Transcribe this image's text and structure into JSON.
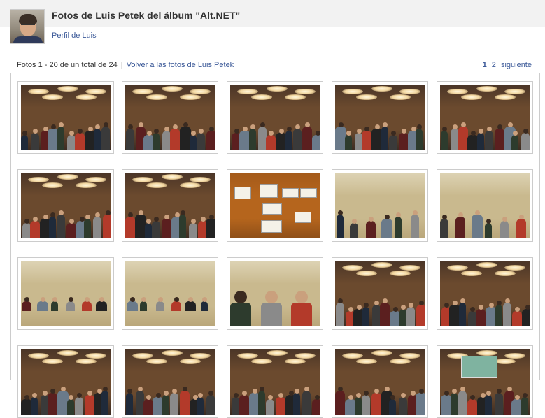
{
  "header": {
    "title": "Fotos de Luis Petek del álbum \"Alt.NET\"",
    "profile_link": "Perfil de Luis"
  },
  "infobar": {
    "count_text": "Fotos 1 - 20 de un total de 24",
    "separator": "|",
    "back_link": "Volver a las fotos de Luis Petek",
    "pages": [
      "1",
      "2"
    ],
    "current_page": "1",
    "next_label": "siguiente"
  },
  "colors": {
    "link": "#3b5998",
    "header_bg": "#f2f2f2",
    "border": "#cccccc"
  },
  "photos": [
    {
      "scene": "meeting-room-crowd",
      "tone": "warm"
    },
    {
      "scene": "meeting-room-crowd",
      "tone": "warm"
    },
    {
      "scene": "meeting-room-crowd",
      "tone": "warm"
    },
    {
      "scene": "meeting-room-crowd",
      "tone": "warm"
    },
    {
      "scene": "meeting-room-crowd",
      "tone": "warm"
    },
    {
      "scene": "meeting-room-crowd",
      "tone": "warm"
    },
    {
      "scene": "meeting-room-crowd",
      "tone": "warm"
    },
    {
      "scene": "wall-with-notes",
      "tone": "orange"
    },
    {
      "scene": "people-seated",
      "tone": "beige"
    },
    {
      "scene": "people-seated",
      "tone": "beige"
    },
    {
      "scene": "circle-of-chairs",
      "tone": "beige"
    },
    {
      "scene": "circle-of-chairs",
      "tone": "beige"
    },
    {
      "scene": "close-faces",
      "tone": "beige"
    },
    {
      "scene": "meeting-room-crowd",
      "tone": "warm"
    },
    {
      "scene": "meeting-room-crowd",
      "tone": "warm"
    },
    {
      "scene": "partial-row",
      "tone": "warm"
    },
    {
      "scene": "partial-row",
      "tone": "warm"
    },
    {
      "scene": "partial-row",
      "tone": "warm"
    },
    {
      "scene": "partial-row",
      "tone": "warm"
    },
    {
      "scene": "projector-screen",
      "tone": "warm"
    }
  ]
}
